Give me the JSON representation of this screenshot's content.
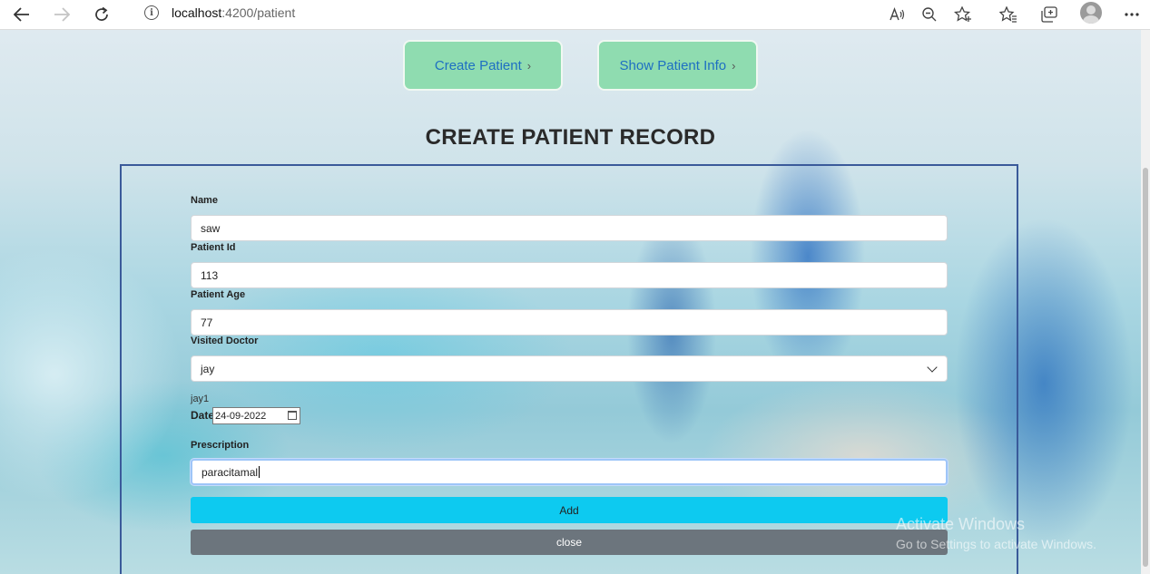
{
  "browser": {
    "url_host": "localhost",
    "url_path": ":4200/patient",
    "icons": [
      "back-icon",
      "forward-icon",
      "reload-icon",
      "info-icon",
      "read-aloud-icon",
      "zoom-out-icon",
      "add-favorite-icon",
      "favorites-icon",
      "collections-icon",
      "profile-avatar",
      "more-icon"
    ]
  },
  "nav": {
    "create_label": "Create Patient",
    "show_label": "Show Patient Info"
  },
  "page": {
    "title": "CREATE PATIENT RECORD"
  },
  "form": {
    "name_label": "Name",
    "name_value": "saw",
    "patient_id_label": "Patient Id",
    "patient_id_value": "113",
    "age_label": "Patient Age",
    "age_value": "77",
    "doctor_label": "Visited Doctor",
    "doctor_value": "jay",
    "doctor_note": "jay1",
    "date_label": "Date",
    "date_value": "24-09-2022",
    "prescription_label": "Prescription",
    "prescription_value": "paracitamal",
    "add_label": "Add",
    "close_label": "close"
  },
  "watermark": {
    "title": "Activate Windows",
    "subtitle": "Go to Settings to activate Windows."
  },
  "colors": {
    "nav_button_bg": "#8fdcb0",
    "nav_button_text": "#1e6fc2",
    "add_button": "#0dcaf0",
    "close_button": "#6c757d",
    "form_border": "#3a5a9a"
  }
}
